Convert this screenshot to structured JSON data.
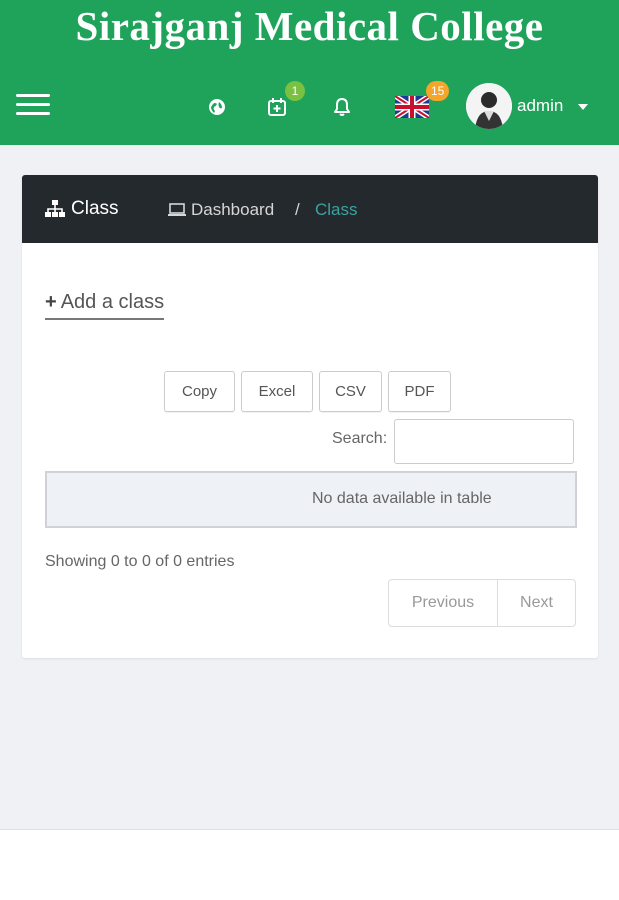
{
  "header": {
    "site_title": "Sirajganj Medical College",
    "calendar_badge": "1",
    "language_badge": "15",
    "user_name": "admin",
    "accent_color": "#1fa35b"
  },
  "card": {
    "title": "Class",
    "breadcrumb": {
      "dashboard": "Dashboard",
      "separator": "/",
      "current": "Class"
    }
  },
  "actions": {
    "add_label": "Add a class",
    "add_icon": "+"
  },
  "export_buttons": {
    "copy": "Copy",
    "excel": "Excel",
    "csv": "CSV",
    "pdf": "PDF"
  },
  "search": {
    "label": "Search:",
    "value": ""
  },
  "table": {
    "empty_message": "No data available in table",
    "info": "Showing 0 to 0 of 0 entries"
  },
  "pagination": {
    "previous": "Previous",
    "next": "Next"
  },
  "icons": [
    "menu-icon",
    "globe-icon",
    "calendar-icon",
    "bell-icon",
    "uk-flag-icon",
    "sitemap-icon",
    "laptop-icon",
    "plus-icon"
  ]
}
